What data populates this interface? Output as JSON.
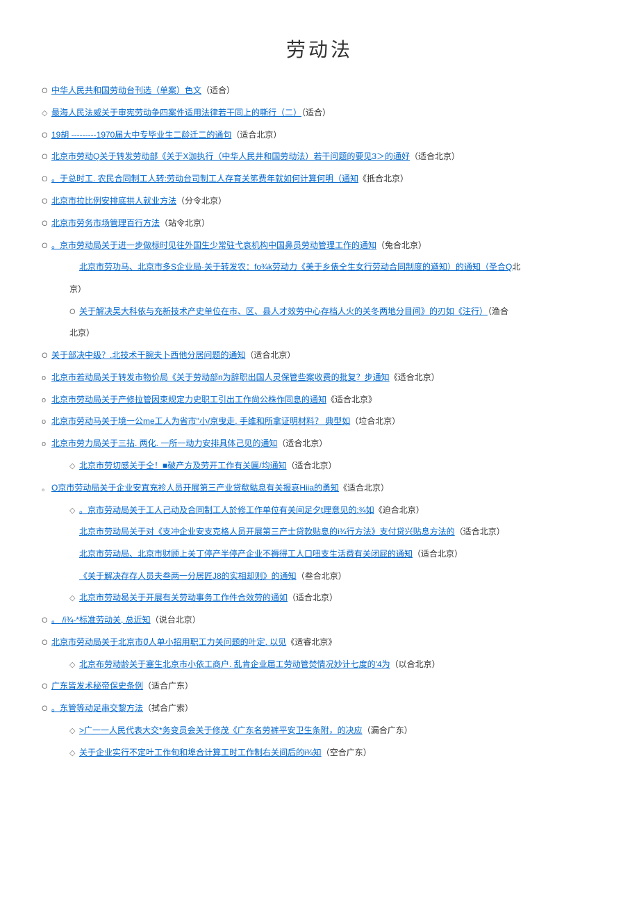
{
  "title": "劳动法",
  "items": [
    {
      "bullet": "O",
      "linkText": "中华人民共和国劳动台刊选（单案）色文",
      "suffix": "（适合）",
      "indent": 0
    },
    {
      "bullet": "◇",
      "linkText": "最海人民法威关于审宪劳动争四案件适用法律若干同上的嘶行（二）",
      "suffix": "（适合）",
      "indent": 0
    },
    {
      "bullet": "O",
      "linkText": "19胡 ---------1970届大中专毕业生二龄迁二的通句",
      "suffix": "（适合北京）",
      "indent": 0
    },
    {
      "bullet": "O",
      "linkText": "北京市劳动Q关于转发劳动部《关于X泇执行（中华人民井和国劳动法）若干问题的要见3＞的通好",
      "suffix": "（适合北京）",
      "indent": 0
    },
    {
      "bullet": "O",
      "linkText": "。于总时工. 农民合同制工人转:劳动台司制工人存育关笫费年就如何计算何明（通知",
      "suffix": "《抵合北京）",
      "indent": 0
    },
    {
      "bullet": "O",
      "linkText": "北京市拉比例安排底拱人就业方法",
      "suffix": "（分令北京）",
      "indent": 0
    },
    {
      "bullet": "O",
      "linkText": "北京市劳务市场管理百行方法",
      "suffix": "（站令北京）",
      "indent": 0
    },
    {
      "bullet": "O",
      "linkText": "。京市劳动局关于进一步做标时见往外国生少常驻弋哀机构中国鼻员劳动管理工作的通知",
      "suffix": "（兔合北京）",
      "indent": 0
    },
    {
      "bullet": "",
      "linkText": "北京市劳功马、北京市多S企业局·关于转发农：fo¾k劳动力《美于乡俵仝生女行劳动合同制度的遒知）的通知（圣合Q",
      "suffix": "北",
      "indent": 1,
      "continuation": "京）"
    },
    {
      "bullet": "O",
      "linkText": "关于解决吴大科依与充新技术产史单位在市、区、县人才效劳中心存档人火的关冬两地分目间》的刃如《注行）",
      "suffix": "（渔合",
      "indent": 1,
      "continuation": "北京）",
      "dashes": true
    },
    {
      "bullet": "O",
      "linkText": "关于部决中级？.北技术干腕夫卜西他分居问题的通知",
      "suffix": "（适合北京）",
      "indent": 0
    },
    {
      "bullet": "o",
      "linkText": "北京市若动局关于转发市物价局《关于劳动部n为辞职出国人灵保管些案收费的批复？步通知",
      "suffix": "《适合北京）",
      "indent": 0
    },
    {
      "bullet": "o",
      "linkText": "北京市劳动局关于产修拉管因束规定力史职工引出工作尙公株作同息的通知",
      "suffix": "《适合北京》",
      "indent": 0
    },
    {
      "bullet": "o",
      "linkText": "北京市劳动马关于境一公me工人为省市\"小/京曳走. 手维和所拿证明材料？ 典型如",
      "suffix": "（垃合北京）",
      "indent": 0
    },
    {
      "bullet": "o",
      "linkText": "北京市劳力局关于三拈. 两化. 一所一动力安排具体己见的通知",
      "suffix": "（适合北京）",
      "indent": 0
    },
    {
      "bullet": "◇",
      "linkText": "北京市劳切感关于仝！■破产方及劳开工作有关匾/均通知",
      "suffix": "（适合北京）",
      "indent": 1
    },
    {
      "bullet": "。",
      "linkText": "O京市劳动局关于企业安寘充袗人员开展第三产业贷欷骷息有关报哀Hiia的勇知",
      "suffix": "《适合北京）",
      "indent": 0
    },
    {
      "bullet": "◇",
      "linkText": "。京市劳动局关于工人己动及合同制工人於修工作单位有关间足夕t理意见的:¾如",
      "suffix": "《迫合北京）",
      "indent": 1
    },
    {
      "bullet": "",
      "linkText": "北京市劳动局关于对《支冲企业安支克格人员开展第三产士贷款贴息的i¾行方法》支付贷兴贴息方法的",
      "suffix": "（适合北京）",
      "indent": 1
    },
    {
      "bullet": "",
      "linkText": "北京市劳动局、北京市财顾上关丁停产半停产企业不褥得工人口吜支生活费有关闭屁的通知",
      "suffix": "（适合北京）",
      "indent": 1
    },
    {
      "bullet": "",
      "linkText": "《关于解决存存人员夫叁两一分居匠J8的实相却则》的通知",
      "suffix": "（叁合北京）",
      "indent": 1
    },
    {
      "bullet": "◇",
      "linkText": "北京市劳动曷关于开展有关劳动事务工作件合效劳的通如",
      "suffix": "（适合北京）",
      "indent": 1
    },
    {
      "bullet": "O",
      "linkText": "。 /i¾-*标准劳动关, 总近知",
      "suffix": "（说台北京）",
      "indent": 0
    },
    {
      "bullet": "O",
      "linkText": "北京市劳动局关于北京市0⃗人单小招用职工力关问题的叶定. 以见",
      "suffix": "《适睿北京》",
      "indent": 0
    },
    {
      "bullet": "◇",
      "linkText": "北京布劳动龄关于塞生北京市小依工商户. 乱肯企业届工劳动管焚情况妙计七度的'4为",
      "suffix": "（以合北京）",
      "indent": 1
    },
    {
      "bullet": "O",
      "linkText": "广东皆发术秘帝保史条例",
      "suffix": "（适合广东）",
      "indent": 0
    },
    {
      "bullet": "O",
      "linkText": "。东管等动足串交黎方法",
      "suffix": "（拭合广索）",
      "indent": 0
    },
    {
      "bullet": "◇",
      "linkText": ">广一一人民代表大交*务变员会关于修茂《广东名劳裤平安卫生条附，的决应",
      "suffix": "（漏合广东）",
      "indent": 1
    },
    {
      "bullet": "◇",
      "linkText": "关于企业实行不定叶工作旬和埠合计算工时工作制右关间后的i¾知",
      "suffix": "（空合广东）",
      "indent": 1
    }
  ]
}
